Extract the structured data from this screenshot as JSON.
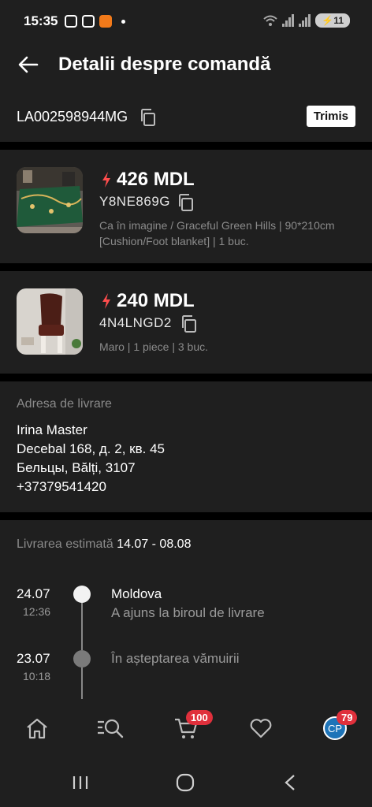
{
  "status_bar": {
    "time": "15:35",
    "battery": "11"
  },
  "header": {
    "title": "Detalii despre comandă"
  },
  "order": {
    "id": "LA002598944MG",
    "status": "Trimis"
  },
  "items": [
    {
      "price": "426 MDL",
      "sku": "Y8NE869G",
      "description": "Ca în imagine / Graceful Green Hills | 90*210cm [Cushion/Foot blanket] | 1 buc."
    },
    {
      "price": "240 MDL",
      "sku": "4N4LNGD2",
      "description": "Maro | 1 piece | 3 buc."
    }
  ],
  "address": {
    "label": "Adresa de livrare",
    "name": "Irina Master",
    "street": "Decebal 168, д. 2, кв. 45",
    "city": "Бельцы, Bălți, 3107",
    "phone": "+37379541420"
  },
  "delivery": {
    "label": "Livrarea estimată",
    "range": "14.07 - 08.08",
    "timeline": [
      {
        "date": "24.07",
        "time": "12:36",
        "title": "Moldova",
        "subtitle": "A ajuns la biroul de livrare"
      },
      {
        "date": "23.07",
        "time": "10:18",
        "title": "",
        "subtitle": "În așteptarea vămuirii"
      }
    ]
  },
  "bottom_nav": {
    "cart_badge": "100",
    "profile_badge": "79",
    "avatar_initials": "CP"
  },
  "colors": {
    "accent_red": "#e0303c",
    "lightning": "#ff4d4d",
    "panel": "#1f1f1f"
  }
}
